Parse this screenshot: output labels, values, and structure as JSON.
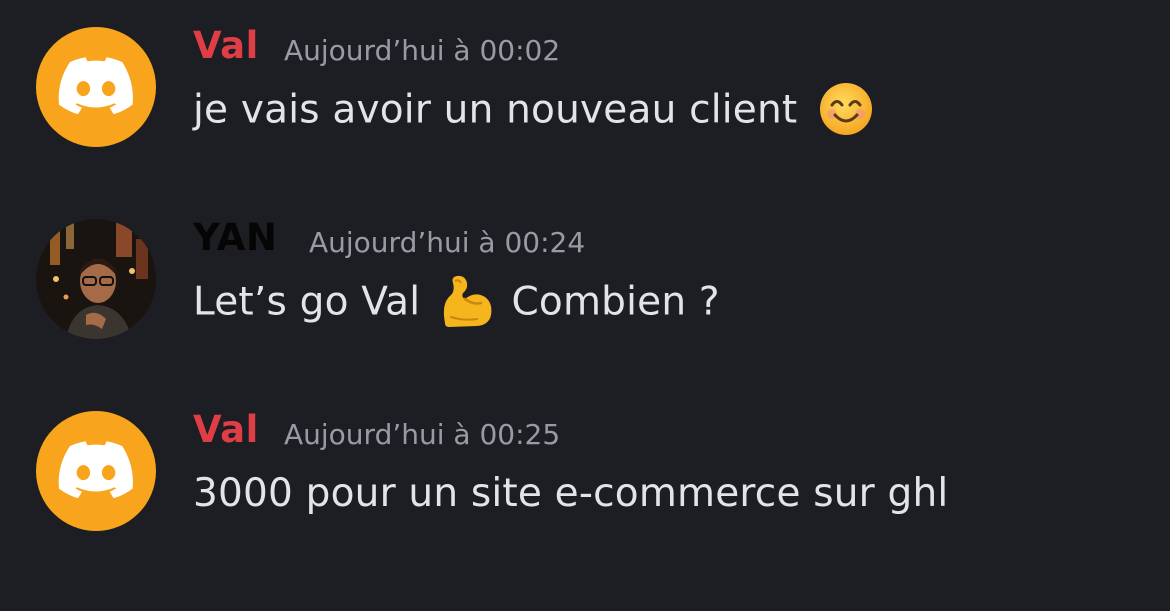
{
  "colors": {
    "background": "#1d1e23",
    "val_name": "#e03e46",
    "yan_name": "#050505",
    "timestamp": "#9a9ba2",
    "message_text": "#e3e4e8",
    "discord_avatar": "#f8a41d"
  },
  "messages": [
    {
      "author": "Val",
      "timestamp": "Aujourd’hui à 00:02",
      "text": "je vais avoir un nouveau client",
      "emoji": "smiling-face-with-smiling-eyes",
      "avatar": "discord-logo-icon"
    },
    {
      "author": "YAN",
      "timestamp": "Aujourd’hui à 00:24",
      "text_before": "Let’s go Val",
      "emoji": "flexed-biceps",
      "text_after": "Combien ?",
      "avatar": "user-photo"
    },
    {
      "author": "Val",
      "timestamp": "Aujourd’hui à 00:25",
      "text": "3000 pour un site e-commerce sur ghl",
      "avatar": "discord-logo-icon"
    }
  ]
}
